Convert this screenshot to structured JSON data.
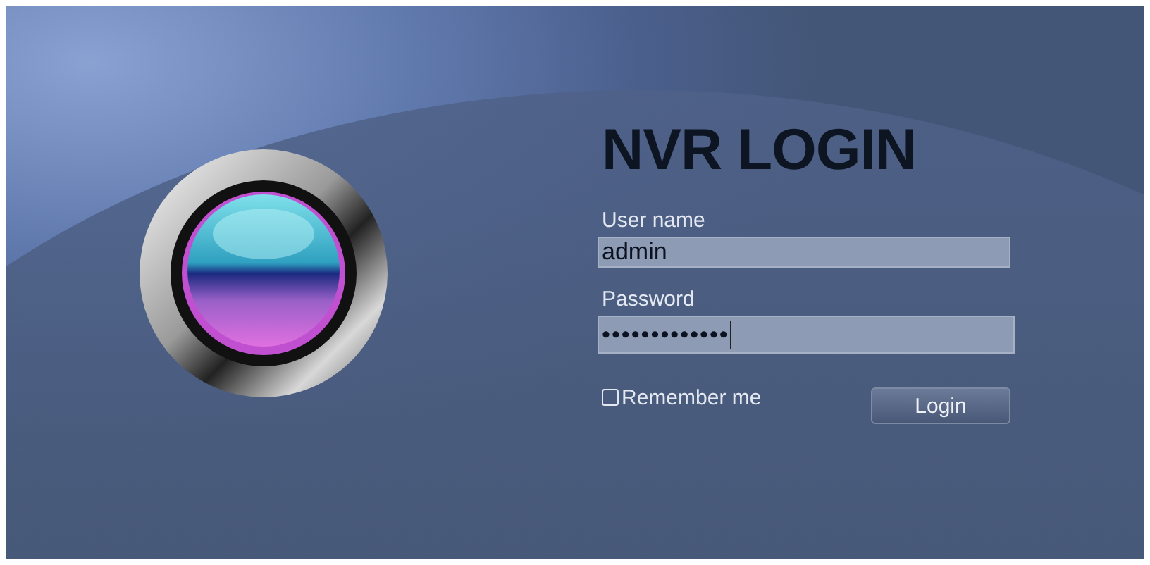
{
  "title": "NVR LOGIN",
  "fields": [
    {
      "label": "User name",
      "value": "admin",
      "kind": "text"
    },
    {
      "label": "Password",
      "value": "•••••••••••••",
      "kind": "password"
    }
  ],
  "remember": {
    "label": "Remember me",
    "checked": false
  },
  "button": "Login"
}
